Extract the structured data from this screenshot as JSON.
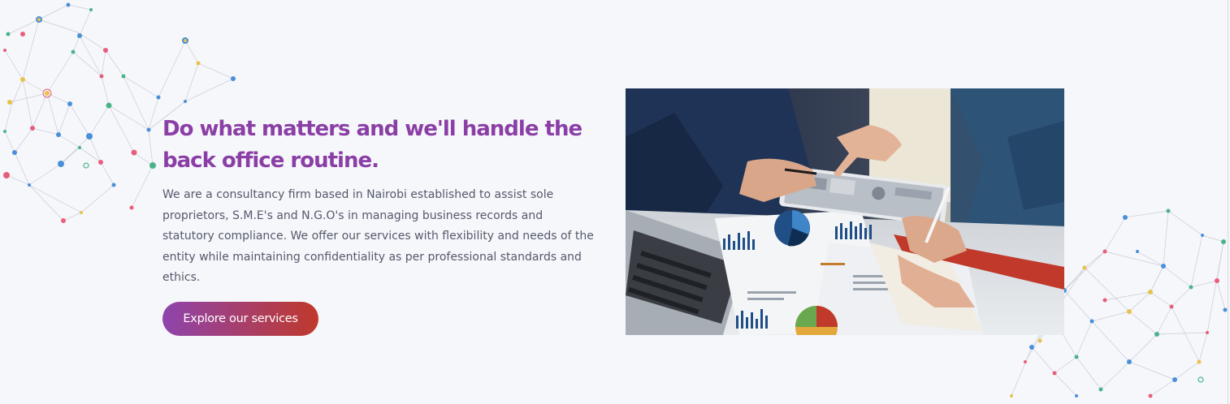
{
  "hero": {
    "headline": "Do what matters and we'll handle the back office routine.",
    "description": "We are a consultancy firm based in Nairobi established to assist sole proprietors, S.M.E's and N.G.O's in managing business records and statutory compliance. We offer our services with flexibility and needs of the entity while maintaining confidentiality as per professional standards and ethics.",
    "cta_label": "Explore our services"
  },
  "image": {
    "alt": "Business team reviewing financial reports on a tablet and documents"
  },
  "colors": {
    "background": "#f6f7fb",
    "headline": "#8b3fa6",
    "body_text": "#55596b",
    "cta_gradient_start": "#8e44ad",
    "cta_gradient_end": "#c0392b"
  }
}
